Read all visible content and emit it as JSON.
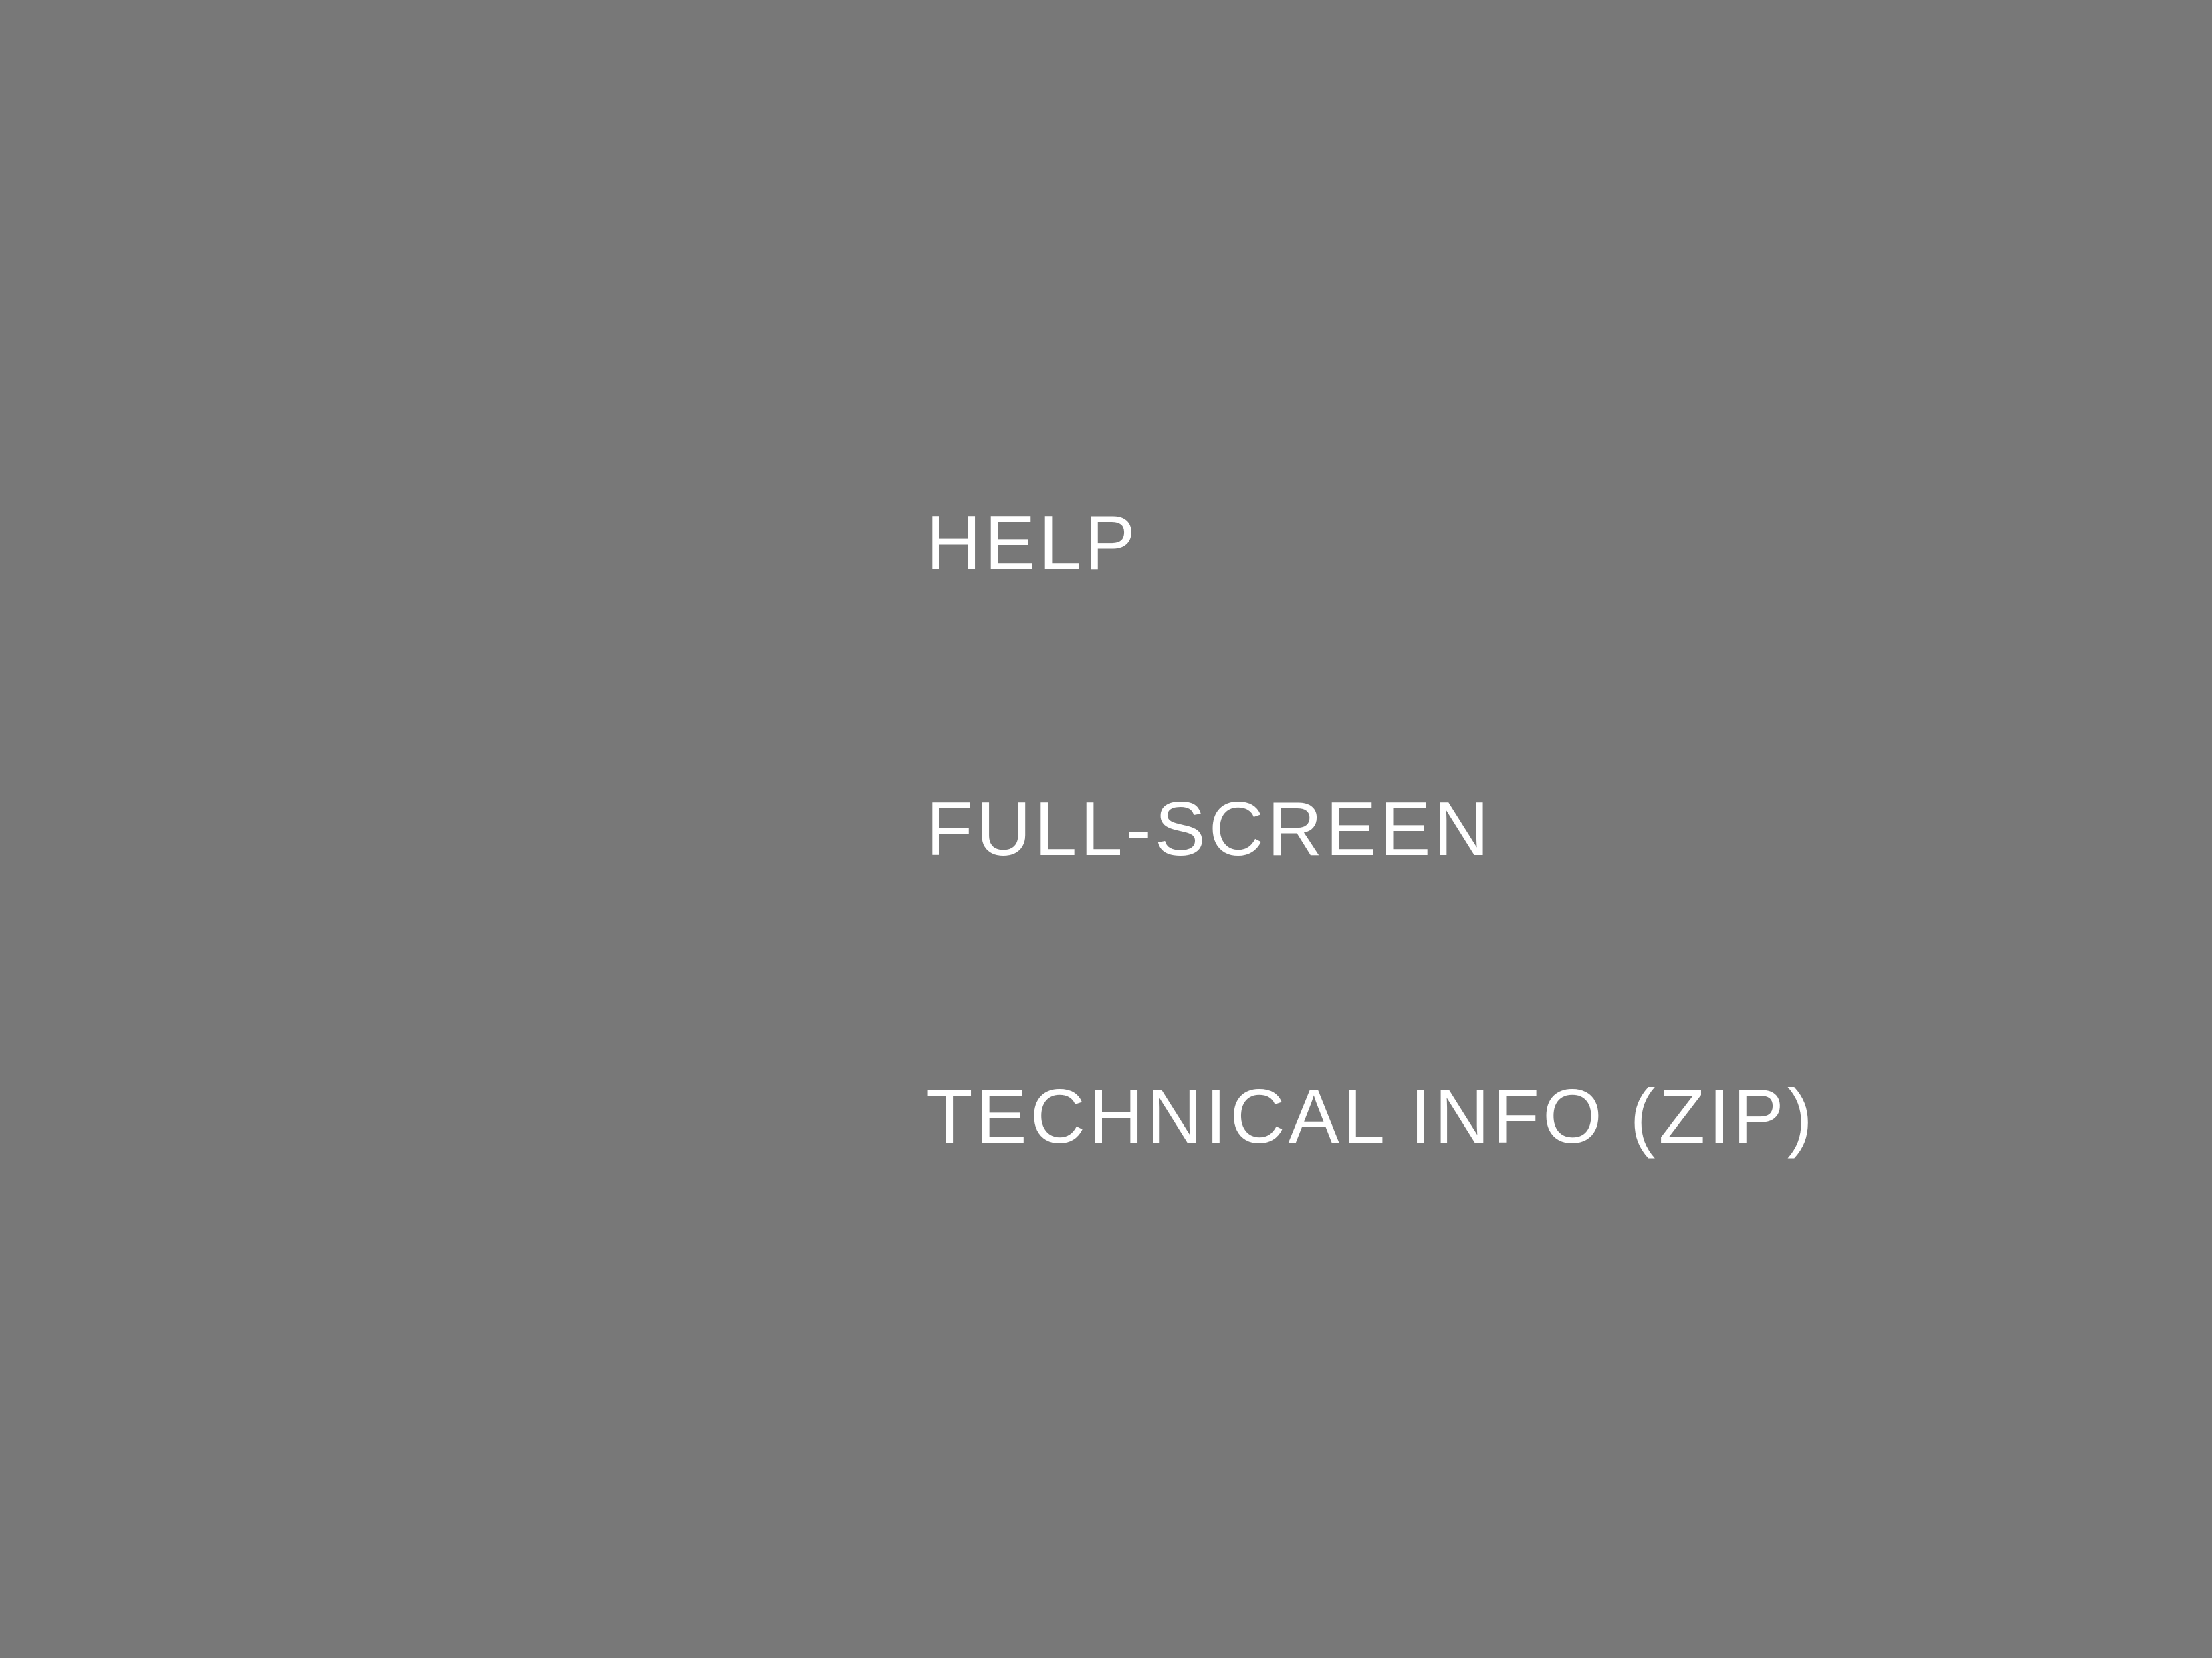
{
  "menu": {
    "items": [
      {
        "id": "help",
        "label": "HELP"
      },
      {
        "id": "full-screen",
        "label": "FULL-SCREEN"
      },
      {
        "id": "technical-info",
        "label": "TECHNICAL INFO (ZIP)"
      }
    ]
  },
  "colors": {
    "background": "#787878",
    "text": "#ffffff"
  }
}
